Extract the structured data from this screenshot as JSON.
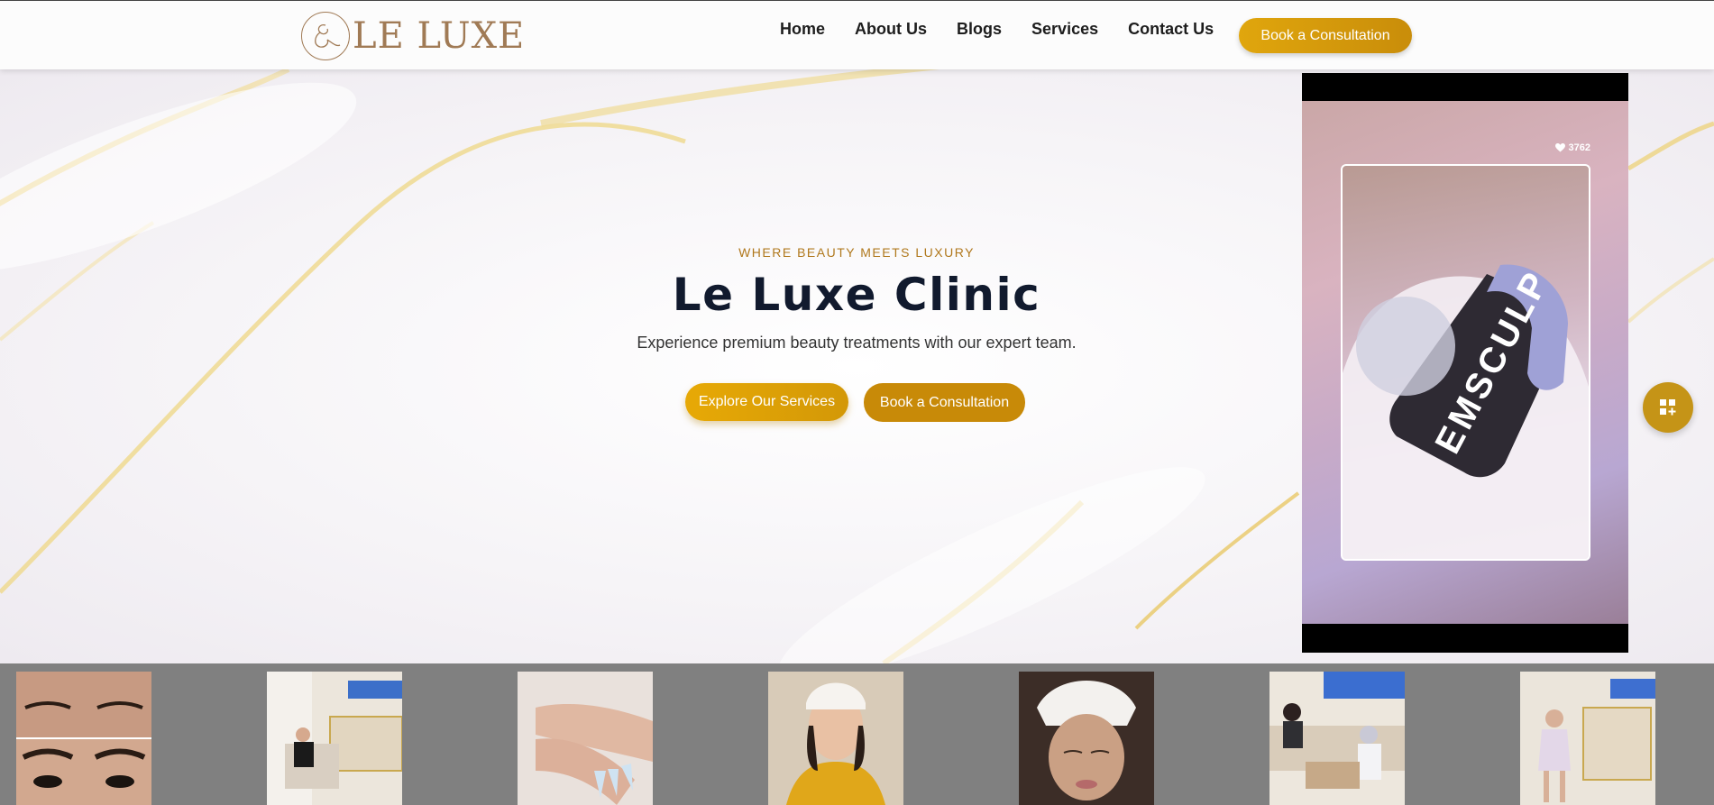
{
  "brand": {
    "name": "LE LUXE"
  },
  "nav": {
    "items": [
      "Home",
      "About Us",
      "Blogs",
      "Services",
      "Contact Us"
    ],
    "cta_label": "Book a Consultation"
  },
  "hero": {
    "tagline": "WHERE BEAUTY MEETS LUXURY",
    "title": "Le Luxe Clinic",
    "subtitle": "Experience premium beauty treatments with our expert team.",
    "primary_button": "Explore Our Services",
    "secondary_button": "Book a Consultation"
  },
  "video": {
    "likes": "3762",
    "device_label": "EMSCULP"
  },
  "fab": {
    "icon": "grid-plus-icon"
  },
  "gallery": {
    "items": [
      {
        "name": "brows-before-after-photo"
      },
      {
        "name": "clinic-client-seated-photo"
      },
      {
        "name": "nails-manicure-photo"
      },
      {
        "name": "facial-client-gold-robe-photo"
      },
      {
        "name": "facial-treatment-photo"
      },
      {
        "name": "pedicure-salon-photo"
      },
      {
        "name": "clinic-client-standing-photo"
      }
    ]
  },
  "colors": {
    "gold": "#c88a08",
    "navy": "#111a2e",
    "tagline": "#b0781c",
    "brand": "#a07a55"
  }
}
